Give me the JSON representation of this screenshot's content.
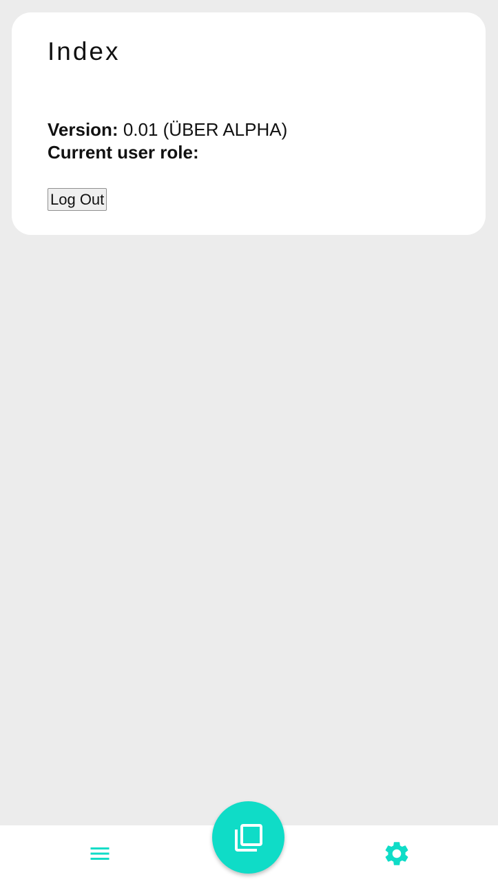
{
  "colors": {
    "accent": "#0fdcc7",
    "background": "#ececec",
    "card": "#ffffff"
  },
  "card": {
    "title": "Index",
    "version_label": "Version:",
    "version_value": " 0.01 (ÜBER ALPHA)",
    "role_label": "Current user role:",
    "role_value": "",
    "logout_label": "Log Out"
  },
  "bottom_nav": {
    "left_icon": "menu-icon",
    "center_icon": "library-icon",
    "right_icon": "gear-icon"
  }
}
